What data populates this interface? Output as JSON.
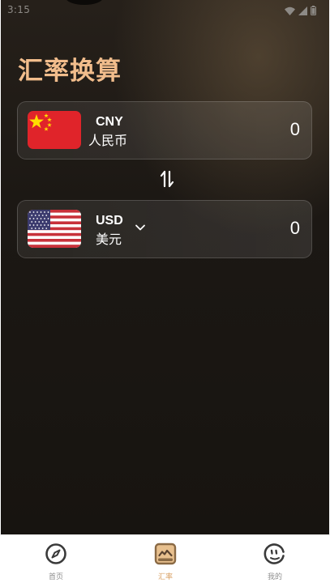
{
  "status_bar": {
    "time": "3:15"
  },
  "header": {
    "title": "汇率换算"
  },
  "from_currency": {
    "code": "CNY",
    "name": "人民币",
    "amount": "0",
    "flag_icon": "china-flag-icon"
  },
  "to_currency": {
    "code": "USD",
    "name": "美元",
    "amount": "0",
    "flag_icon": "usa-flag-icon"
  },
  "tabs": [
    {
      "label": "首页",
      "icon": "compass-icon",
      "active": false
    },
    {
      "label": "汇率",
      "icon": "exchange-rate-icon",
      "active": true
    },
    {
      "label": "我的",
      "icon": "profile-face-icon",
      "active": false
    }
  ],
  "colors": {
    "accent": "#f2bd8c",
    "tab_active": "#d9a063",
    "background": "#1c1814"
  }
}
